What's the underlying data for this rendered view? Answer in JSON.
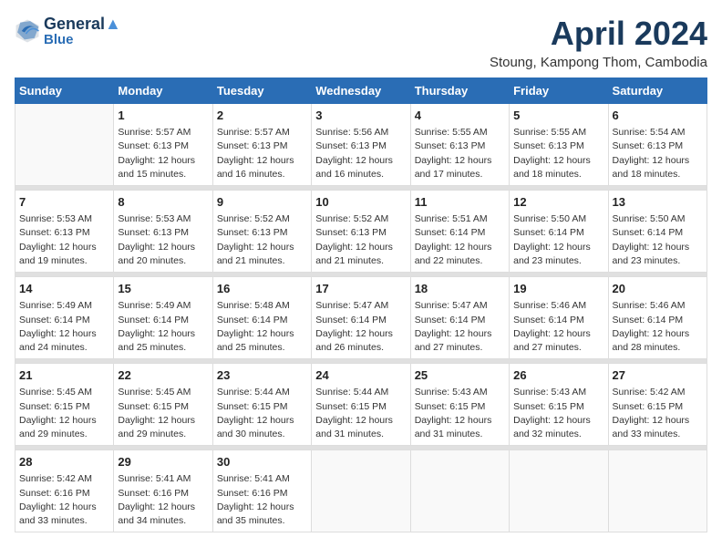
{
  "logo": {
    "line1": "General",
    "line2": "Blue"
  },
  "title": "April 2024",
  "subtitle": "Stoung, Kampong Thom, Cambodia",
  "days_of_week": [
    "Sunday",
    "Monday",
    "Tuesday",
    "Wednesday",
    "Thursday",
    "Friday",
    "Saturday"
  ],
  "weeks": [
    [
      {
        "num": "",
        "info": ""
      },
      {
        "num": "1",
        "info": "Sunrise: 5:57 AM\nSunset: 6:13 PM\nDaylight: 12 hours\nand 15 minutes."
      },
      {
        "num": "2",
        "info": "Sunrise: 5:57 AM\nSunset: 6:13 PM\nDaylight: 12 hours\nand 16 minutes."
      },
      {
        "num": "3",
        "info": "Sunrise: 5:56 AM\nSunset: 6:13 PM\nDaylight: 12 hours\nand 16 minutes."
      },
      {
        "num": "4",
        "info": "Sunrise: 5:55 AM\nSunset: 6:13 PM\nDaylight: 12 hours\nand 17 minutes."
      },
      {
        "num": "5",
        "info": "Sunrise: 5:55 AM\nSunset: 6:13 PM\nDaylight: 12 hours\nand 18 minutes."
      },
      {
        "num": "6",
        "info": "Sunrise: 5:54 AM\nSunset: 6:13 PM\nDaylight: 12 hours\nand 18 minutes."
      }
    ],
    [
      {
        "num": "7",
        "info": "Sunrise: 5:53 AM\nSunset: 6:13 PM\nDaylight: 12 hours\nand 19 minutes."
      },
      {
        "num": "8",
        "info": "Sunrise: 5:53 AM\nSunset: 6:13 PM\nDaylight: 12 hours\nand 20 minutes."
      },
      {
        "num": "9",
        "info": "Sunrise: 5:52 AM\nSunset: 6:13 PM\nDaylight: 12 hours\nand 21 minutes."
      },
      {
        "num": "10",
        "info": "Sunrise: 5:52 AM\nSunset: 6:13 PM\nDaylight: 12 hours\nand 21 minutes."
      },
      {
        "num": "11",
        "info": "Sunrise: 5:51 AM\nSunset: 6:14 PM\nDaylight: 12 hours\nand 22 minutes."
      },
      {
        "num": "12",
        "info": "Sunrise: 5:50 AM\nSunset: 6:14 PM\nDaylight: 12 hours\nand 23 minutes."
      },
      {
        "num": "13",
        "info": "Sunrise: 5:50 AM\nSunset: 6:14 PM\nDaylight: 12 hours\nand 23 minutes."
      }
    ],
    [
      {
        "num": "14",
        "info": "Sunrise: 5:49 AM\nSunset: 6:14 PM\nDaylight: 12 hours\nand 24 minutes."
      },
      {
        "num": "15",
        "info": "Sunrise: 5:49 AM\nSunset: 6:14 PM\nDaylight: 12 hours\nand 25 minutes."
      },
      {
        "num": "16",
        "info": "Sunrise: 5:48 AM\nSunset: 6:14 PM\nDaylight: 12 hours\nand 25 minutes."
      },
      {
        "num": "17",
        "info": "Sunrise: 5:47 AM\nSunset: 6:14 PM\nDaylight: 12 hours\nand 26 minutes."
      },
      {
        "num": "18",
        "info": "Sunrise: 5:47 AM\nSunset: 6:14 PM\nDaylight: 12 hours\nand 27 minutes."
      },
      {
        "num": "19",
        "info": "Sunrise: 5:46 AM\nSunset: 6:14 PM\nDaylight: 12 hours\nand 27 minutes."
      },
      {
        "num": "20",
        "info": "Sunrise: 5:46 AM\nSunset: 6:14 PM\nDaylight: 12 hours\nand 28 minutes."
      }
    ],
    [
      {
        "num": "21",
        "info": "Sunrise: 5:45 AM\nSunset: 6:15 PM\nDaylight: 12 hours\nand 29 minutes."
      },
      {
        "num": "22",
        "info": "Sunrise: 5:45 AM\nSunset: 6:15 PM\nDaylight: 12 hours\nand 29 minutes."
      },
      {
        "num": "23",
        "info": "Sunrise: 5:44 AM\nSunset: 6:15 PM\nDaylight: 12 hours\nand 30 minutes."
      },
      {
        "num": "24",
        "info": "Sunrise: 5:44 AM\nSunset: 6:15 PM\nDaylight: 12 hours\nand 31 minutes."
      },
      {
        "num": "25",
        "info": "Sunrise: 5:43 AM\nSunset: 6:15 PM\nDaylight: 12 hours\nand 31 minutes."
      },
      {
        "num": "26",
        "info": "Sunrise: 5:43 AM\nSunset: 6:15 PM\nDaylight: 12 hours\nand 32 minutes."
      },
      {
        "num": "27",
        "info": "Sunrise: 5:42 AM\nSunset: 6:15 PM\nDaylight: 12 hours\nand 33 minutes."
      }
    ],
    [
      {
        "num": "28",
        "info": "Sunrise: 5:42 AM\nSunset: 6:16 PM\nDaylight: 12 hours\nand 33 minutes."
      },
      {
        "num": "29",
        "info": "Sunrise: 5:41 AM\nSunset: 6:16 PM\nDaylight: 12 hours\nand 34 minutes."
      },
      {
        "num": "30",
        "info": "Sunrise: 5:41 AM\nSunset: 6:16 PM\nDaylight: 12 hours\nand 35 minutes."
      },
      {
        "num": "",
        "info": ""
      },
      {
        "num": "",
        "info": ""
      },
      {
        "num": "",
        "info": ""
      },
      {
        "num": "",
        "info": ""
      }
    ]
  ]
}
